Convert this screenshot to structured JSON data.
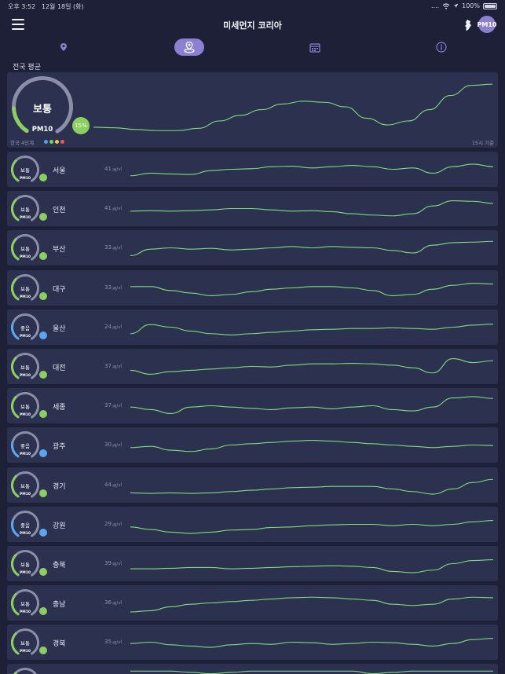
{
  "status_bar": {
    "time": "오후 3:52",
    "date": "12월 18일 (화)",
    "signal": "....",
    "battery_pct": "100%"
  },
  "header": {
    "title": "미세먼지 코리아",
    "pm_badge": "PM10"
  },
  "tabs": [
    {
      "name": "location",
      "icon": "location-pin-icon",
      "active": false
    },
    {
      "name": "region",
      "icon": "region-map-icon",
      "active": true
    },
    {
      "name": "calendar",
      "icon": "calendar-icon",
      "active": false
    },
    {
      "name": "info",
      "icon": "info-icon",
      "active": false
    }
  ],
  "national": {
    "label": "전국 평균",
    "status": "보통",
    "pollutant": "PM10",
    "percent": "15%",
    "gauge_level": 0.15,
    "scale_label": "한국 4단계",
    "scale_colors": [
      "#4aa3f0",
      "#7ccf5a",
      "#f0c84a",
      "#ee5a5a"
    ],
    "ref_time": "15시 기준",
    "trend": [
      0.14,
      0.13,
      0.1,
      0.08,
      0.08,
      0.12,
      0.25,
      0.35,
      0.45,
      0.55,
      0.6,
      0.58,
      0.5,
      0.3,
      0.18,
      0.25,
      0.45,
      0.7,
      0.88,
      0.9
    ]
  },
  "colors": {
    "good": "#5aa6f2",
    "normal": "#8ccf60",
    "line": "#7fdc7a"
  },
  "unit": "㎍/㎥",
  "cities": [
    {
      "name": "서울",
      "status": "보통",
      "value": "41",
      "level": "normal",
      "trend": [
        0.25,
        0.35,
        0.32,
        0.3,
        0.45,
        0.5,
        0.52,
        0.6,
        0.62,
        0.55,
        0.6,
        0.65,
        0.6,
        0.5,
        0.55,
        0.35,
        0.6,
        0.7,
        0.6
      ]
    },
    {
      "name": "인천",
      "status": "보통",
      "value": "41",
      "level": "normal",
      "trend": [
        0.4,
        0.42,
        0.4,
        0.42,
        0.45,
        0.5,
        0.5,
        0.45,
        0.4,
        0.42,
        0.38,
        0.3,
        0.25,
        0.22,
        0.3,
        0.6,
        0.8,
        0.78,
        0.7
      ]
    },
    {
      "name": "부산",
      "status": "보통",
      "value": "33",
      "level": "normal",
      "trend": [
        0.2,
        0.45,
        0.5,
        0.45,
        0.48,
        0.42,
        0.45,
        0.5,
        0.55,
        0.5,
        0.55,
        0.52,
        0.5,
        0.4,
        0.3,
        0.6,
        0.7,
        0.72,
        0.75
      ]
    },
    {
      "name": "대구",
      "status": "보통",
      "value": "33",
      "level": "normal",
      "trend": [
        0.55,
        0.55,
        0.4,
        0.3,
        0.2,
        0.25,
        0.35,
        0.45,
        0.5,
        0.55,
        0.55,
        0.5,
        0.4,
        0.2,
        0.25,
        0.45,
        0.6,
        0.68,
        0.65
      ]
    },
    {
      "name": "울산",
      "status": "좋음",
      "value": "24",
      "level": "good",
      "trend": [
        0.25,
        0.6,
        0.5,
        0.35,
        0.25,
        0.2,
        0.25,
        0.3,
        0.35,
        0.4,
        0.42,
        0.45,
        0.45,
        0.48,
        0.45,
        0.42,
        0.5,
        0.58,
        0.62
      ]
    },
    {
      "name": "대전",
      "status": "보통",
      "value": "37",
      "level": "normal",
      "trend": [
        0.35,
        0.2,
        0.3,
        0.35,
        0.4,
        0.45,
        0.5,
        0.48,
        0.55,
        0.6,
        0.6,
        0.62,
        0.6,
        0.55,
        0.45,
        0.25,
        0.8,
        0.65,
        0.72
      ]
    },
    {
      "name": "세종",
      "status": "보통",
      "value": "37",
      "level": "normal",
      "trend": [
        0.45,
        0.35,
        0.2,
        0.45,
        0.5,
        0.45,
        0.4,
        0.35,
        0.42,
        0.45,
        0.38,
        0.45,
        0.5,
        0.35,
        0.3,
        0.45,
        0.8,
        0.85,
        0.78
      ]
    },
    {
      "name": "광주",
      "status": "좋음",
      "value": "30",
      "level": "good",
      "trend": [
        0.4,
        0.45,
        0.3,
        0.25,
        0.35,
        0.5,
        0.55,
        0.6,
        0.65,
        0.68,
        0.65,
        0.6,
        0.55,
        0.5,
        0.45,
        0.4,
        0.45,
        0.5,
        0.48
      ]
    },
    {
      "name": "경기",
      "status": "보통",
      "value": "44",
      "level": "normal",
      "trend": [
        0.2,
        0.18,
        0.2,
        0.18,
        0.2,
        0.25,
        0.3,
        0.35,
        0.4,
        0.42,
        0.45,
        0.45,
        0.45,
        0.35,
        0.25,
        0.15,
        0.35,
        0.6,
        0.72
      ]
    },
    {
      "name": "강원",
      "status": "좋음",
      "value": "29",
      "level": "good",
      "trend": [
        0.4,
        0.3,
        0.2,
        0.15,
        0.2,
        0.28,
        0.3,
        0.38,
        0.4,
        0.45,
        0.48,
        0.5,
        0.5,
        0.45,
        0.5,
        0.45,
        0.5,
        0.6,
        0.65
      ]
    },
    {
      "name": "충북",
      "status": "보통",
      "value": "39",
      "level": "normal",
      "trend": [
        0.3,
        0.3,
        0.32,
        0.35,
        0.35,
        0.3,
        0.32,
        0.35,
        0.38,
        0.4,
        0.42,
        0.4,
        0.35,
        0.2,
        0.15,
        0.25,
        0.5,
        0.62,
        0.65
      ]
    },
    {
      "name": "충남",
      "status": "보통",
      "value": "36",
      "level": "normal",
      "trend": [
        0.15,
        0.2,
        0.35,
        0.45,
        0.5,
        0.55,
        0.6,
        0.65,
        0.7,
        0.72,
        0.7,
        0.65,
        0.6,
        0.45,
        0.4,
        0.45,
        0.65,
        0.72,
        0.7
      ]
    },
    {
      "name": "경북",
      "status": "보통",
      "value": "35",
      "level": "normal",
      "trend": [
        0.45,
        0.5,
        0.4,
        0.35,
        0.3,
        0.4,
        0.45,
        0.42,
        0.5,
        0.48,
        0.42,
        0.45,
        0.5,
        0.48,
        0.42,
        0.35,
        0.45,
        0.6,
        0.65
      ]
    },
    {
      "name": "",
      "status": "",
      "value": "",
      "level": "normal",
      "trend": [
        0.9,
        0.9,
        0.9,
        0.85,
        0.8,
        0.85,
        0.9,
        0.9,
        0.9,
        0.9,
        0.9,
        0.9,
        0.8,
        0.85,
        0.9,
        0.9,
        0.9,
        0.9,
        0.9
      ]
    }
  ]
}
